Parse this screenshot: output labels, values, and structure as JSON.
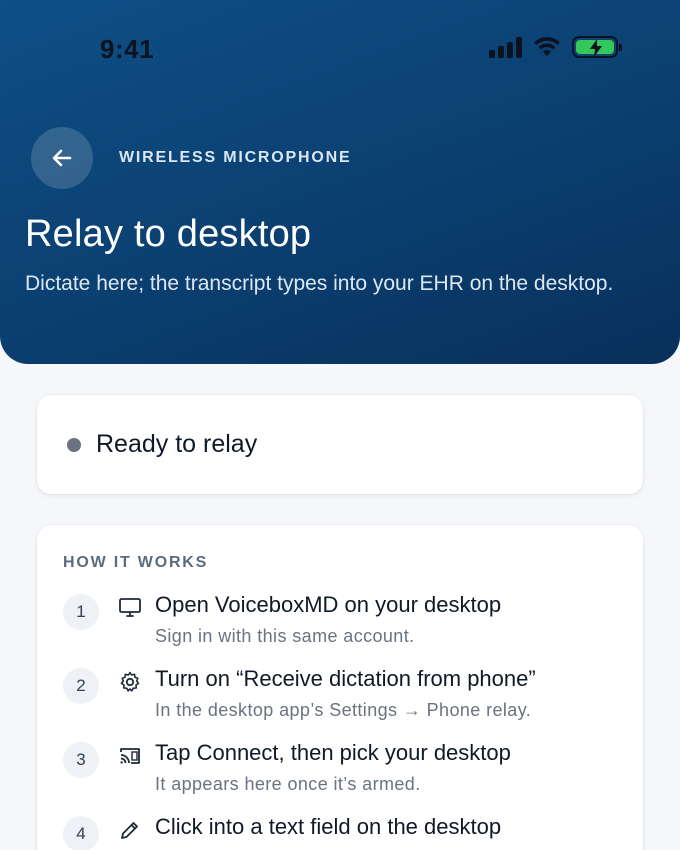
{
  "status_bar": {
    "time": "9:41",
    "icons": [
      "cellular-signal-icon",
      "wifi-icon",
      "battery-charging-icon"
    ],
    "battery_color": "#34c759"
  },
  "header": {
    "back_icon": "arrow-left-icon",
    "eyebrow": "WIRELESS MICROPHONE",
    "title": "Relay to desktop",
    "subtitle": "Dictate here; the transcript types into your EHR on the desktop.",
    "gradient_colors": [
      "#0e4f86",
      "#08305a"
    ]
  },
  "status_card": {
    "text": "Ready to relay",
    "dot_color": "#6b7280"
  },
  "how_it_works": {
    "title": "HOW IT WORKS",
    "steps": [
      {
        "number": "1",
        "icon": "monitor-icon",
        "title": "Open VoiceboxMD on your desktop",
        "desc": "Sign in with this same account."
      },
      {
        "number": "2",
        "icon": "gear-icon",
        "title": "Turn on “Receive dictation from phone”",
        "desc": "In the desktop app’s Settings → Phone relay."
      },
      {
        "number": "3",
        "icon": "cast-icon",
        "title": "Tap Connect, then pick your desktop",
        "desc": "It appears here once it’s armed."
      },
      {
        "number": "4",
        "icon": "pencil-icon",
        "title": "Click into a text field on the desktop",
        "desc": ""
      }
    ]
  }
}
